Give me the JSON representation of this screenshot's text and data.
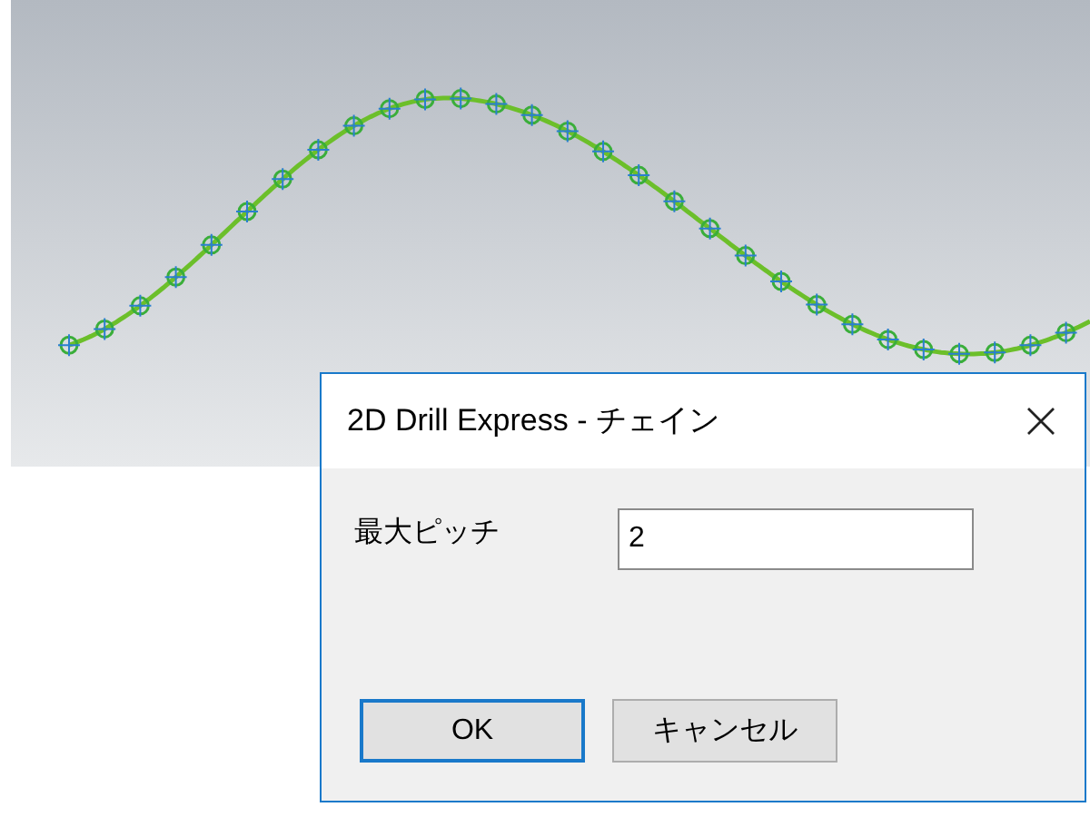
{
  "dialog": {
    "title": "2D Drill Express - チェイン",
    "field": {
      "label": "最大ピッチ",
      "value": "2"
    },
    "buttons": [
      {
        "label": "OK",
        "default": true
      },
      {
        "label": "キャンセル",
        "default": false
      }
    ]
  }
}
